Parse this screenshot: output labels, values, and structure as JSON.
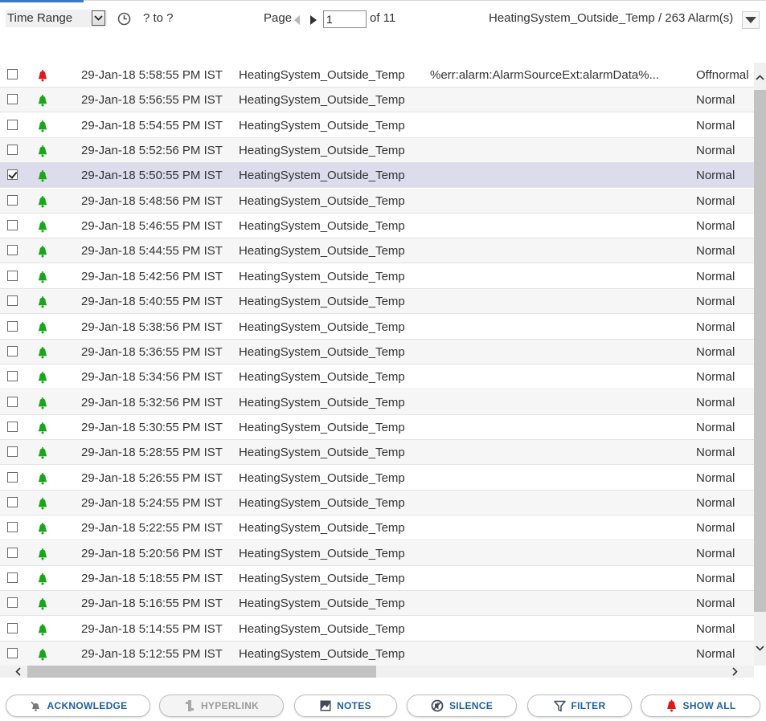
{
  "toolbar": {
    "time_range_label": "Time Range",
    "range_text": "? to ?",
    "page_label": "Page",
    "page_value": "1",
    "page_of": "of 11",
    "summary": "HeatingSystem_Outside_Temp / 263 Alarm(s)"
  },
  "colors": {
    "bell_alarm": "#e0191b",
    "bell_normal": "#1aa51a",
    "selected_row": "#dcdcec",
    "button_text": "#1f5f9e"
  },
  "rows": [
    {
      "checked": false,
      "bell": "alarm",
      "time": "29-Jan-18 5:58:55 PM IST",
      "source": "HeatingSystem_Outside_Temp",
      "message": "%err:alarm:AlarmSourceExt:alarmData%...",
      "state": "Offnormal"
    },
    {
      "checked": false,
      "bell": "normal",
      "time": "29-Jan-18 5:56:55 PM IST",
      "source": "HeatingSystem_Outside_Temp",
      "message": "",
      "state": "Normal"
    },
    {
      "checked": false,
      "bell": "normal",
      "time": "29-Jan-18 5:54:55 PM IST",
      "source": "HeatingSystem_Outside_Temp",
      "message": "",
      "state": "Normal"
    },
    {
      "checked": false,
      "bell": "normal",
      "time": "29-Jan-18 5:52:56 PM IST",
      "source": "HeatingSystem_Outside_Temp",
      "message": "",
      "state": "Normal"
    },
    {
      "checked": true,
      "bell": "normal",
      "time": "29-Jan-18 5:50:55 PM IST",
      "source": "HeatingSystem_Outside_Temp",
      "message": "",
      "state": "Normal"
    },
    {
      "checked": false,
      "bell": "normal",
      "time": "29-Jan-18 5:48:56 PM IST",
      "source": "HeatingSystem_Outside_Temp",
      "message": "",
      "state": "Normal"
    },
    {
      "checked": false,
      "bell": "normal",
      "time": "29-Jan-18 5:46:55 PM IST",
      "source": "HeatingSystem_Outside_Temp",
      "message": "",
      "state": "Normal"
    },
    {
      "checked": false,
      "bell": "normal",
      "time": "29-Jan-18 5:44:55 PM IST",
      "source": "HeatingSystem_Outside_Temp",
      "message": "",
      "state": "Normal"
    },
    {
      "checked": false,
      "bell": "normal",
      "time": "29-Jan-18 5:42:56 PM IST",
      "source": "HeatingSystem_Outside_Temp",
      "message": "",
      "state": "Normal"
    },
    {
      "checked": false,
      "bell": "normal",
      "time": "29-Jan-18 5:40:55 PM IST",
      "source": "HeatingSystem_Outside_Temp",
      "message": "",
      "state": "Normal"
    },
    {
      "checked": false,
      "bell": "normal",
      "time": "29-Jan-18 5:38:56 PM IST",
      "source": "HeatingSystem_Outside_Temp",
      "message": "",
      "state": "Normal"
    },
    {
      "checked": false,
      "bell": "normal",
      "time": "29-Jan-18 5:36:55 PM IST",
      "source": "HeatingSystem_Outside_Temp",
      "message": "",
      "state": "Normal"
    },
    {
      "checked": false,
      "bell": "normal",
      "time": "29-Jan-18 5:34:56 PM IST",
      "source": "HeatingSystem_Outside_Temp",
      "message": "",
      "state": "Normal"
    },
    {
      "checked": false,
      "bell": "normal",
      "time": "29-Jan-18 5:32:56 PM IST",
      "source": "HeatingSystem_Outside_Temp",
      "message": "",
      "state": "Normal"
    },
    {
      "checked": false,
      "bell": "normal",
      "time": "29-Jan-18 5:30:55 PM IST",
      "source": "HeatingSystem_Outside_Temp",
      "message": "",
      "state": "Normal"
    },
    {
      "checked": false,
      "bell": "normal",
      "time": "29-Jan-18 5:28:55 PM IST",
      "source": "HeatingSystem_Outside_Temp",
      "message": "",
      "state": "Normal"
    },
    {
      "checked": false,
      "bell": "normal",
      "time": "29-Jan-18 5:26:55 PM IST",
      "source": "HeatingSystem_Outside_Temp",
      "message": "",
      "state": "Normal"
    },
    {
      "checked": false,
      "bell": "normal",
      "time": "29-Jan-18 5:24:55 PM IST",
      "source": "HeatingSystem_Outside_Temp",
      "message": "",
      "state": "Normal"
    },
    {
      "checked": false,
      "bell": "normal",
      "time": "29-Jan-18 5:22:55 PM IST",
      "source": "HeatingSystem_Outside_Temp",
      "message": "",
      "state": "Normal"
    },
    {
      "checked": false,
      "bell": "normal",
      "time": "29-Jan-18 5:20:56 PM IST",
      "source": "HeatingSystem_Outside_Temp",
      "message": "",
      "state": "Normal"
    },
    {
      "checked": false,
      "bell": "normal",
      "time": "29-Jan-18 5:18:55 PM IST",
      "source": "HeatingSystem_Outside_Temp",
      "message": "",
      "state": "Normal"
    },
    {
      "checked": false,
      "bell": "normal",
      "time": "29-Jan-18 5:16:55 PM IST",
      "source": "HeatingSystem_Outside_Temp",
      "message": "",
      "state": "Normal"
    },
    {
      "checked": false,
      "bell": "normal",
      "time": "29-Jan-18 5:14:55 PM IST",
      "source": "HeatingSystem_Outside_Temp",
      "message": "",
      "state": "Normal"
    },
    {
      "checked": false,
      "bell": "normal",
      "time": "29-Jan-18 5:12:55 PM IST",
      "source": "HeatingSystem_Outside_Temp",
      "message": "",
      "state": "Normal"
    }
  ],
  "buttons": {
    "acknowledge": "ACKNOWLEDGE",
    "hyperlink": "HYPERLINK",
    "notes": "NOTES",
    "silence": "SILENCE",
    "filter": "FILTER",
    "show_all": "SHOW ALL"
  }
}
